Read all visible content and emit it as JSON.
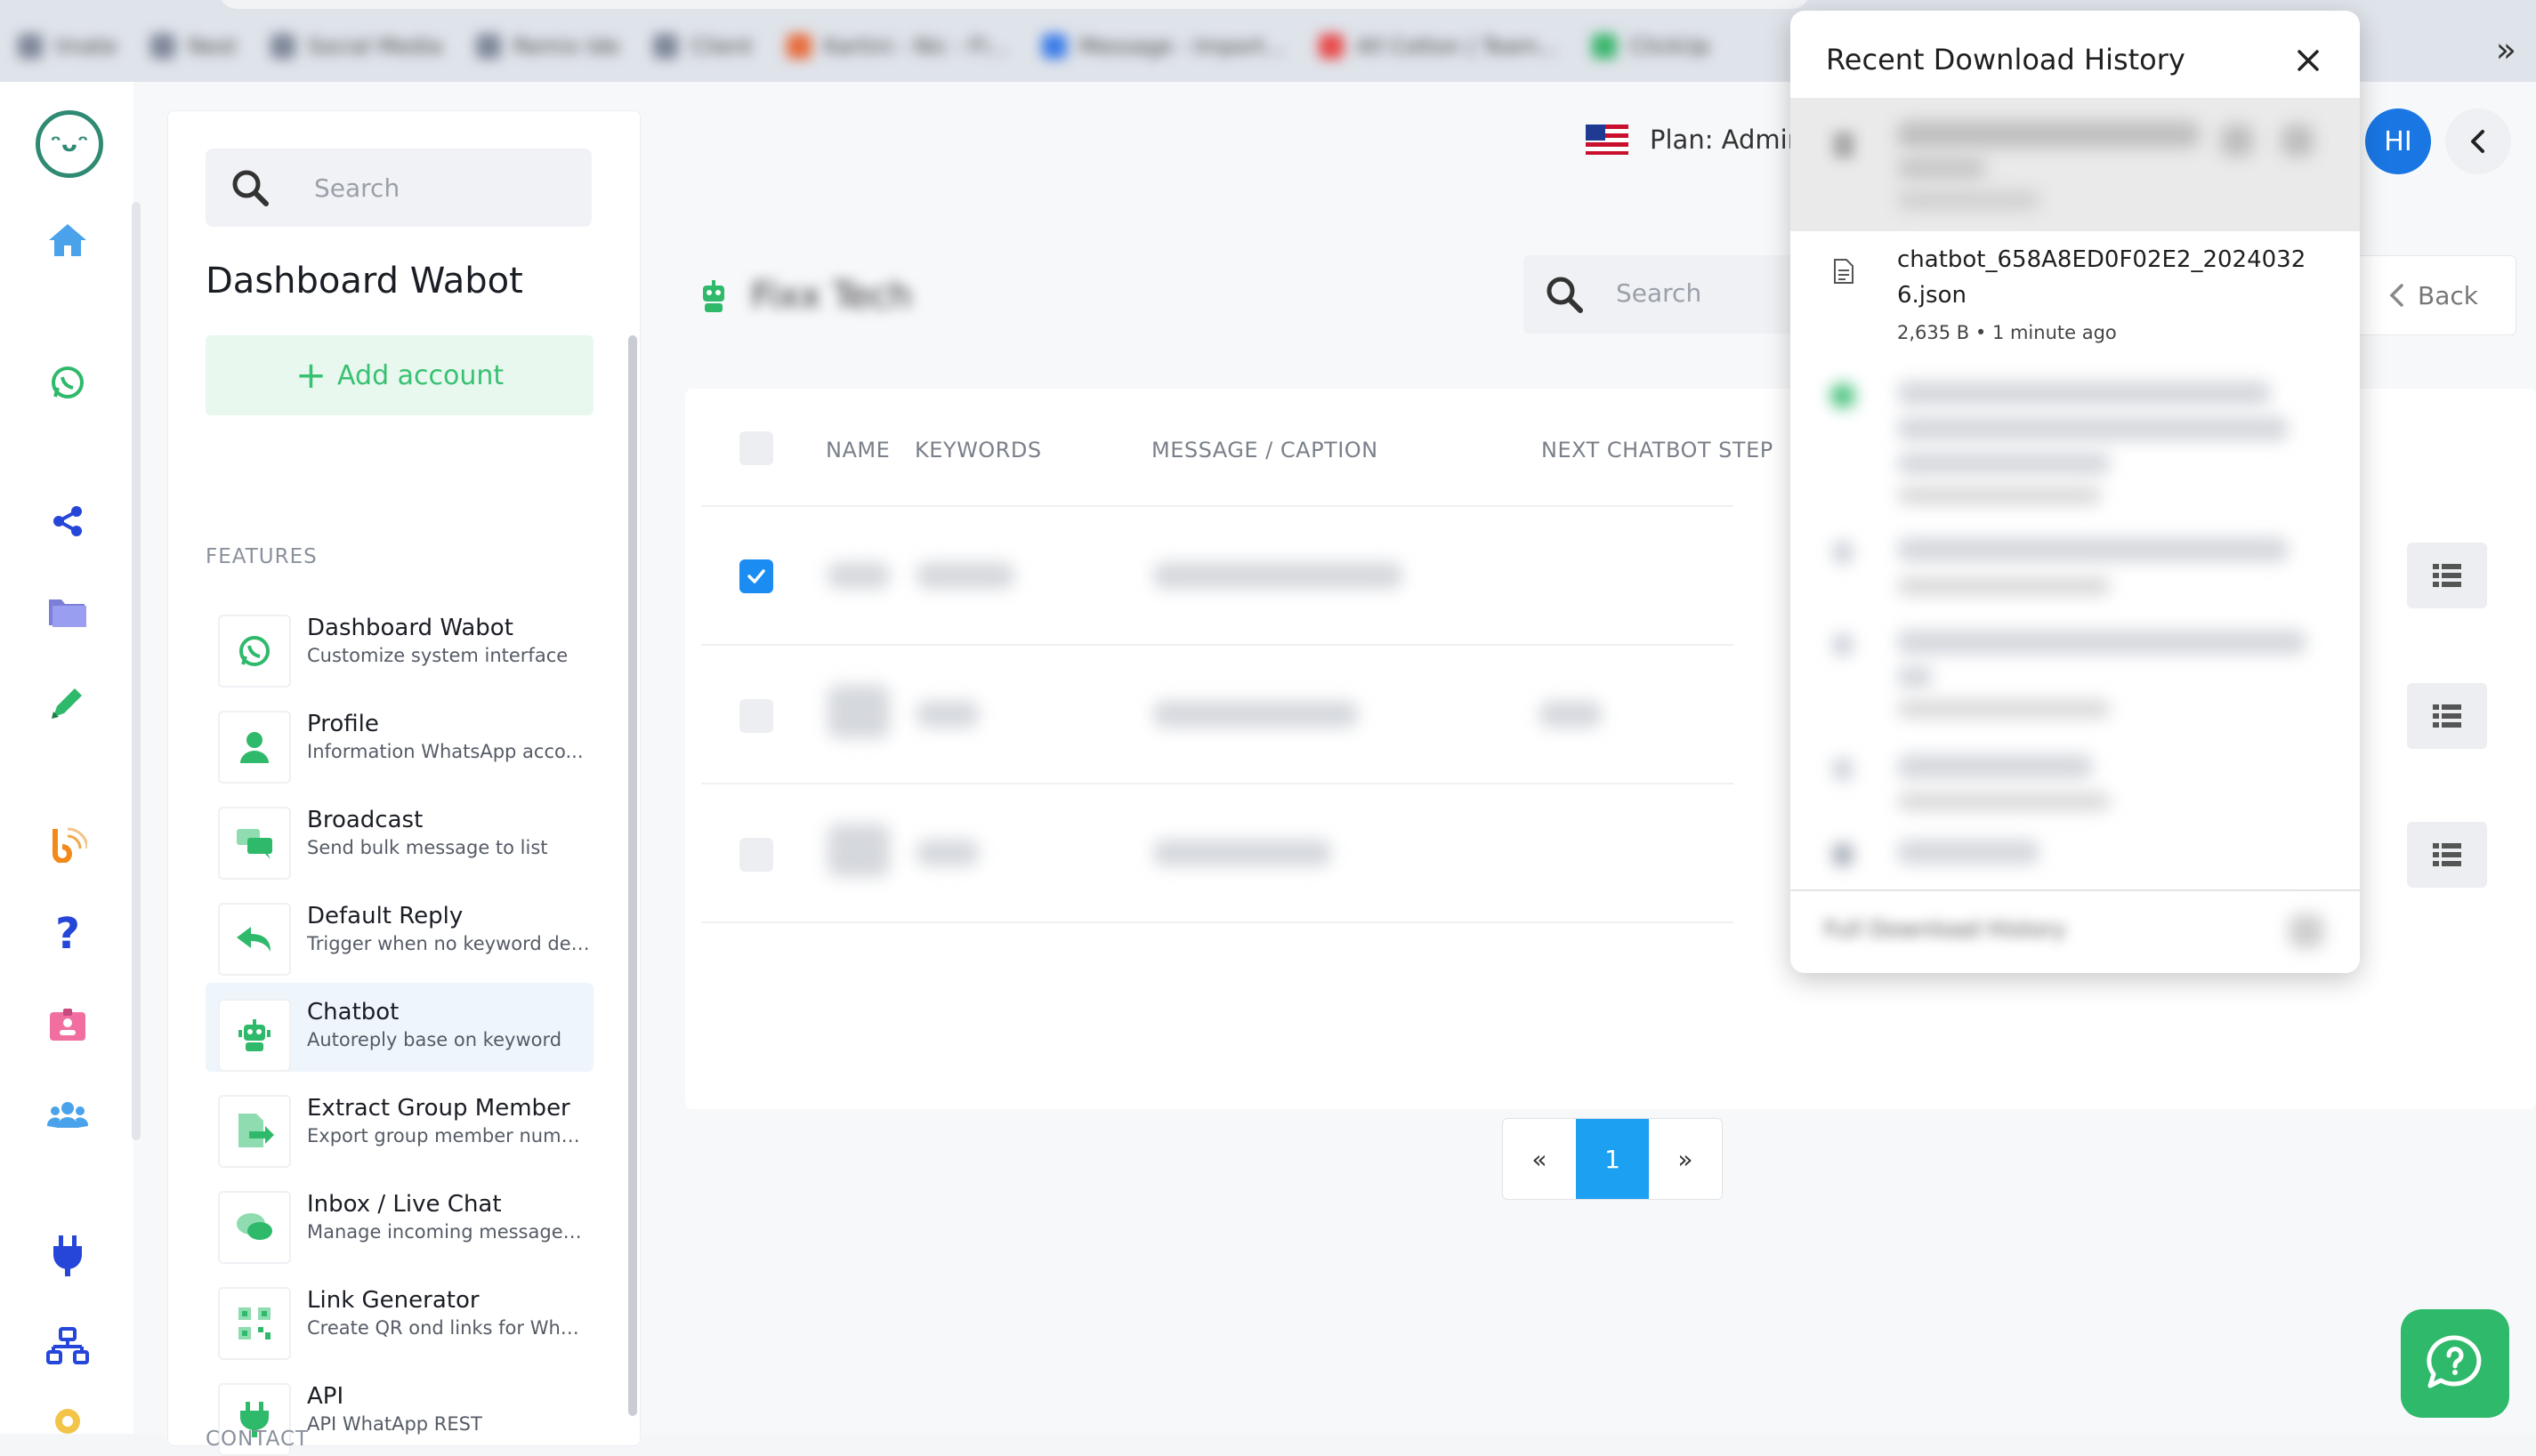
{
  "browser": {
    "bookmarks": [
      "Imate",
      "Nest",
      "Social Media",
      "Remix Ide",
      "Client",
      "Kartini - Nic - Fl...",
      "Message - Import...",
      "All Cotton | Team...",
      "ClickUp"
    ],
    "overflow": "»"
  },
  "rail": {
    "logo_text": "ᵔᴗᵔ",
    "icons": [
      "home-icon",
      "whatsapp-icon",
      "share-icon",
      "folder-icon",
      "edit-icon",
      "rss-icon",
      "help-icon",
      "id-card-icon",
      "users-icon",
      "plug-icon",
      "sitemap-icon",
      "settings-icon"
    ]
  },
  "panel": {
    "search_placeholder": "Search",
    "title": "Dashboard Wabot",
    "add_account": "Add account",
    "features_label": "FEATURES",
    "contact_label": "CONTACT",
    "features": [
      {
        "title": "Dashboard Wabot",
        "desc": "Customize system interface",
        "icon": "whatsapp-icon"
      },
      {
        "title": "Profile",
        "desc": "Information WhatsApp acco...",
        "icon": "user-icon"
      },
      {
        "title": "Broadcast",
        "desc": "Send bulk message to list",
        "icon": "chat-bubbles-icon"
      },
      {
        "title": "Default Reply",
        "desc": "Trigger when no keyword det...",
        "icon": "reply-icon"
      },
      {
        "title": "Chatbot",
        "desc": "Autoreply base on keyword",
        "icon": "robot-icon"
      },
      {
        "title": "Extract Group Member",
        "desc": "Export group member number",
        "icon": "export-icon"
      },
      {
        "title": "Inbox / Live Chat",
        "desc": "Manage incoming messages...",
        "icon": "inbox-chat-icon"
      },
      {
        "title": "Link Generator",
        "desc": "Create QR ond links for What...",
        "icon": "qr-code-icon"
      },
      {
        "title": "API",
        "desc": "API WhatApp REST",
        "icon": "plug-icon"
      }
    ]
  },
  "header": {
    "plan": "Plan: Admir",
    "avatar": "HI"
  },
  "main": {
    "bot_name": "Fixx Tech",
    "search_placeholder": "Search",
    "back": "Back",
    "columns": [
      "NAME",
      "KEYWORDS",
      "MESSAGE / CAPTION",
      "NEXT CHATBOT STEP"
    ],
    "rows": [
      {
        "checked": true
      },
      {
        "checked": false
      },
      {
        "checked": false
      }
    ],
    "pagination": {
      "prev": "«",
      "current": "1",
      "next": "»"
    }
  },
  "popup": {
    "title": "Recent Download History",
    "items": [
      {
        "name": "chatbot_658A8ED0F02E2_20240326.json",
        "meta": "2,635 B • 1 minute ago"
      }
    ],
    "footer": "Full Download History"
  }
}
